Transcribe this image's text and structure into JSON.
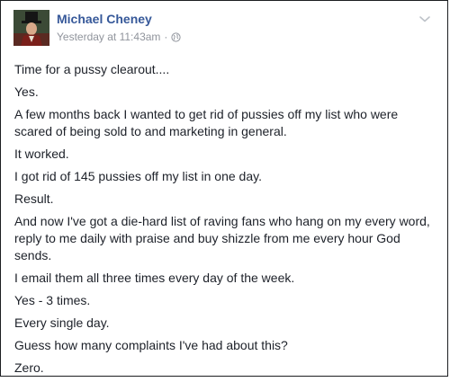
{
  "post": {
    "author": "Michael Cheney",
    "timestamp": "Yesterday at 11:43am",
    "separator": "·",
    "privacy_icon": "globe-icon",
    "menu_icon": "chevron-down-icon",
    "avatar_icon": "avatar",
    "paragraphs": [
      "Time for a pussy clearout....",
      "Yes.",
      "A few months back I wanted to get rid of pussies off my list who were scared of being sold to and marketing in general.",
      "It worked.",
      "I got rid of 145 pussies off my list in one day.",
      "Result.",
      "And now I've got a die-hard list of raving fans who hang on my every word, reply to me daily with praise and buy shizzle from me every hour God sends.",
      "I email them all three times every day of the week.",
      "Yes - 3 times.",
      "Every single day.",
      "Guess how many complaints I've had about this?",
      "Zero."
    ]
  },
  "colors": {
    "author_link": "#365899",
    "meta_text": "#90949c",
    "body_text": "#1d2129",
    "border": "#1c1e21"
  }
}
